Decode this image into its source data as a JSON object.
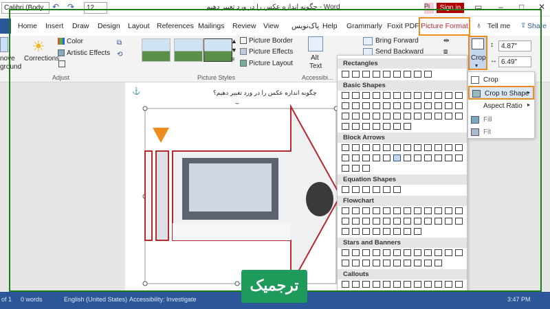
{
  "titlebar": {
    "font_name": "Calibri (Body",
    "font_size": "12",
    "document_title": "چگونه اندازه عکس را در ورد تغییر دهیم - Word",
    "pink_button": "Pi",
    "signin": "Sign in"
  },
  "tabs": [
    "Home",
    "Insert",
    "Draw",
    "Design",
    "Layout",
    "References",
    "Mailings",
    "Review",
    "View",
    "پاک‌نویس",
    "Help",
    "Grammarly",
    "Foxit PDF",
    "Picture Format",
    "Tell me",
    "Share"
  ],
  "ribbon": {
    "remove_background": [
      "nove",
      "ground"
    ],
    "corrections": "Corrections",
    "color": "Color",
    "artistic_effects": "Artistic Effects",
    "adjust_label": "Adjust",
    "picture_border": "Picture Border",
    "picture_effects": "Picture Effects",
    "picture_layout": "Picture Layout",
    "picture_styles_label": "Picture Styles",
    "alt_text": [
      "Alt",
      "Text"
    ],
    "accessibility_label": "Accessibi...",
    "bring_forward": "Bring Forward",
    "send_backward": "Send Backward",
    "crop": "Crop",
    "height": "4.87\"",
    "width": "6.49\""
  },
  "document": {
    "heading": "چگونه اندازه عکس را در ورد تغییر دهیم؟"
  },
  "shapes_gallery": {
    "sections": [
      "Rectangles",
      "Basic Shapes",
      "Block Arrows",
      "Equation Shapes",
      "Flowchart",
      "Stars and Banners",
      "Callouts"
    ]
  },
  "crop_menu": {
    "items": [
      "Crop",
      "Crop to Shape",
      "Aspect Ratio",
      "Fill",
      "Fit"
    ]
  },
  "statusbar": {
    "page": "of 1",
    "words": "0 words",
    "language": "English (United States)",
    "accessibility": "Accessibility: Investigate",
    "time": "3:47 PM"
  },
  "watermark": {
    "text": "ترجمیک"
  },
  "colors": {
    "accent_orange": "#ed8b1f",
    "frame_green": "#1a7d1a",
    "word_blue": "#2b579a",
    "highlight_red": "#b3292e",
    "logo_green": "#1e9a5a"
  }
}
